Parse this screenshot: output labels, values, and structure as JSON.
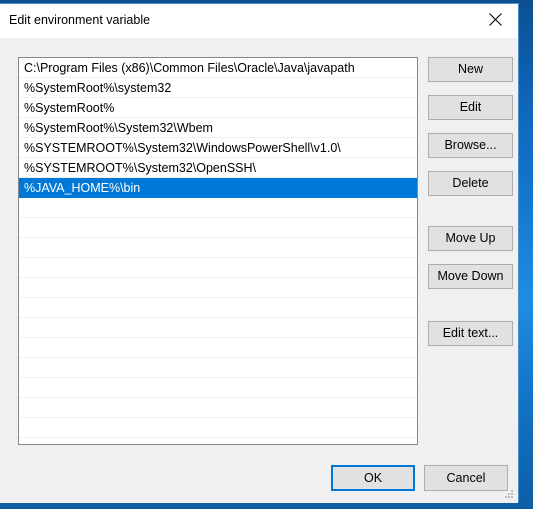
{
  "window": {
    "title": "Edit environment variable",
    "close_icon": "close-icon",
    "accent_color": "#0078d7",
    "body_color": "#f0f0f0",
    "titlebar_color": "#ffffff"
  },
  "list": {
    "entries": [
      "C:\\Program Files (x86)\\Common Files\\Oracle\\Java\\javapath",
      "%SystemRoot%\\system32",
      "%SystemRoot%",
      "%SystemRoot%\\System32\\Wbem",
      "%SYSTEMROOT%\\System32\\WindowsPowerShell\\v1.0\\",
      "%SYSTEMROOT%\\System32\\OpenSSH\\",
      "%JAVA_HOME%\\bin"
    ],
    "selected_index": 6,
    "empty_row_count": 13,
    "selection_color": "#0078d7",
    "selection_text_color": "#ffffff"
  },
  "side_buttons": {
    "new": "New",
    "edit": "Edit",
    "browse": "Browse...",
    "delete": "Delete",
    "move_up": "Move Up",
    "move_down": "Move Down",
    "edit_text": "Edit text..."
  },
  "footer": {
    "ok": "OK",
    "cancel": "Cancel"
  }
}
